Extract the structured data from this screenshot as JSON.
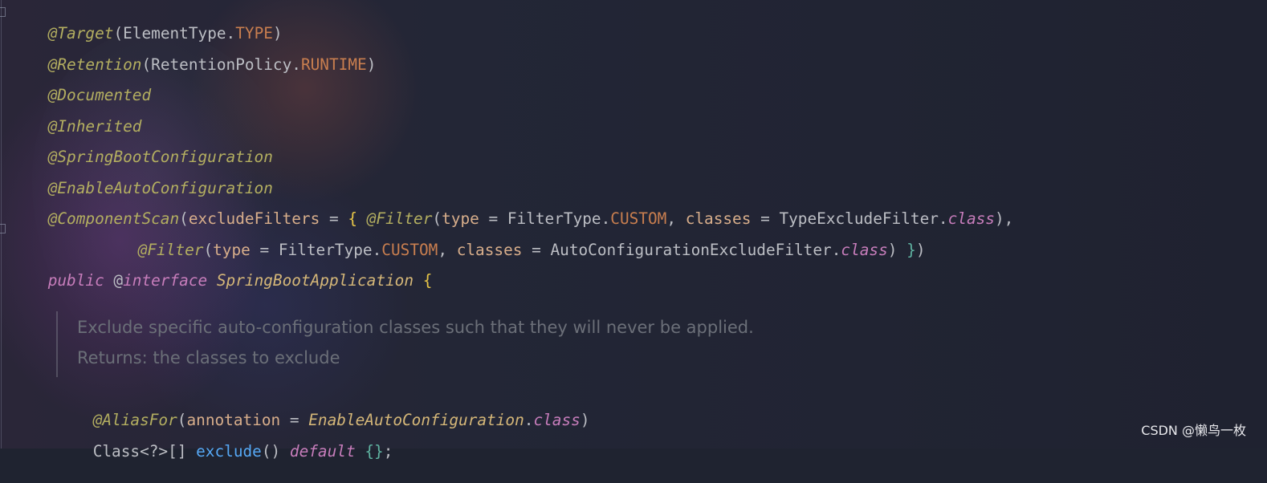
{
  "editor": {
    "lines": [
      {
        "segments": [
          "@Target",
          "(",
          "ElementType",
          ".",
          "TYPE",
          ")"
        ]
      },
      {
        "segments": [
          "@Retention",
          "(",
          "RetentionPolicy",
          ".",
          "RUNTIME",
          ")"
        ]
      },
      {
        "segments": [
          "@Documented"
        ]
      },
      {
        "segments": [
          "@Inherited"
        ]
      },
      {
        "segments": [
          "@SpringBootConfiguration"
        ]
      },
      {
        "segments": [
          "@EnableAutoConfiguration"
        ]
      },
      {
        "segments": [
          "@ComponentScan",
          "(",
          "excludeFilters",
          " = ",
          "{ ",
          "@Filter",
          "(",
          "type",
          " = ",
          "FilterType",
          ".",
          "CUSTOM",
          ", ",
          "classes",
          " = ",
          "TypeExcludeFilter",
          ".",
          "class",
          ")",
          ","
        ]
      },
      {
        "segments": [
          "@Filter",
          "(",
          "type",
          " = ",
          "FilterType",
          ".",
          "CUSTOM",
          ", ",
          "classes",
          " = ",
          "AutoConfigurationExcludeFilter",
          ".",
          "class",
          ")",
          " }",
          ")"
        ]
      },
      {
        "segments": [
          "public",
          " @",
          "interface",
          " ",
          "SpringBootApplication",
          " {"
        ]
      },
      {
        "segments": [
          "@AliasFor",
          "(",
          "annotation",
          " = ",
          "EnableAutoConfiguration",
          ".",
          "class",
          ")"
        ]
      },
      {
        "segments": [
          "Class<?>[] ",
          "exclude",
          "()",
          " ",
          "default",
          " ",
          "{}",
          ";"
        ]
      }
    ]
  },
  "doc": {
    "line1": "Exclude specific auto-configuration classes such that they will never be applied.",
    "line2": "Returns: the classes to exclude"
  },
  "watermark": "CSDN @懒鸟一枚",
  "colors": {
    "annotation": "#b3ae60",
    "keyword": "#cf8e6d",
    "constant": "#c77dbb",
    "method": "#56a8f5",
    "comment": "#6b6f78",
    "background": "#1f2330"
  }
}
